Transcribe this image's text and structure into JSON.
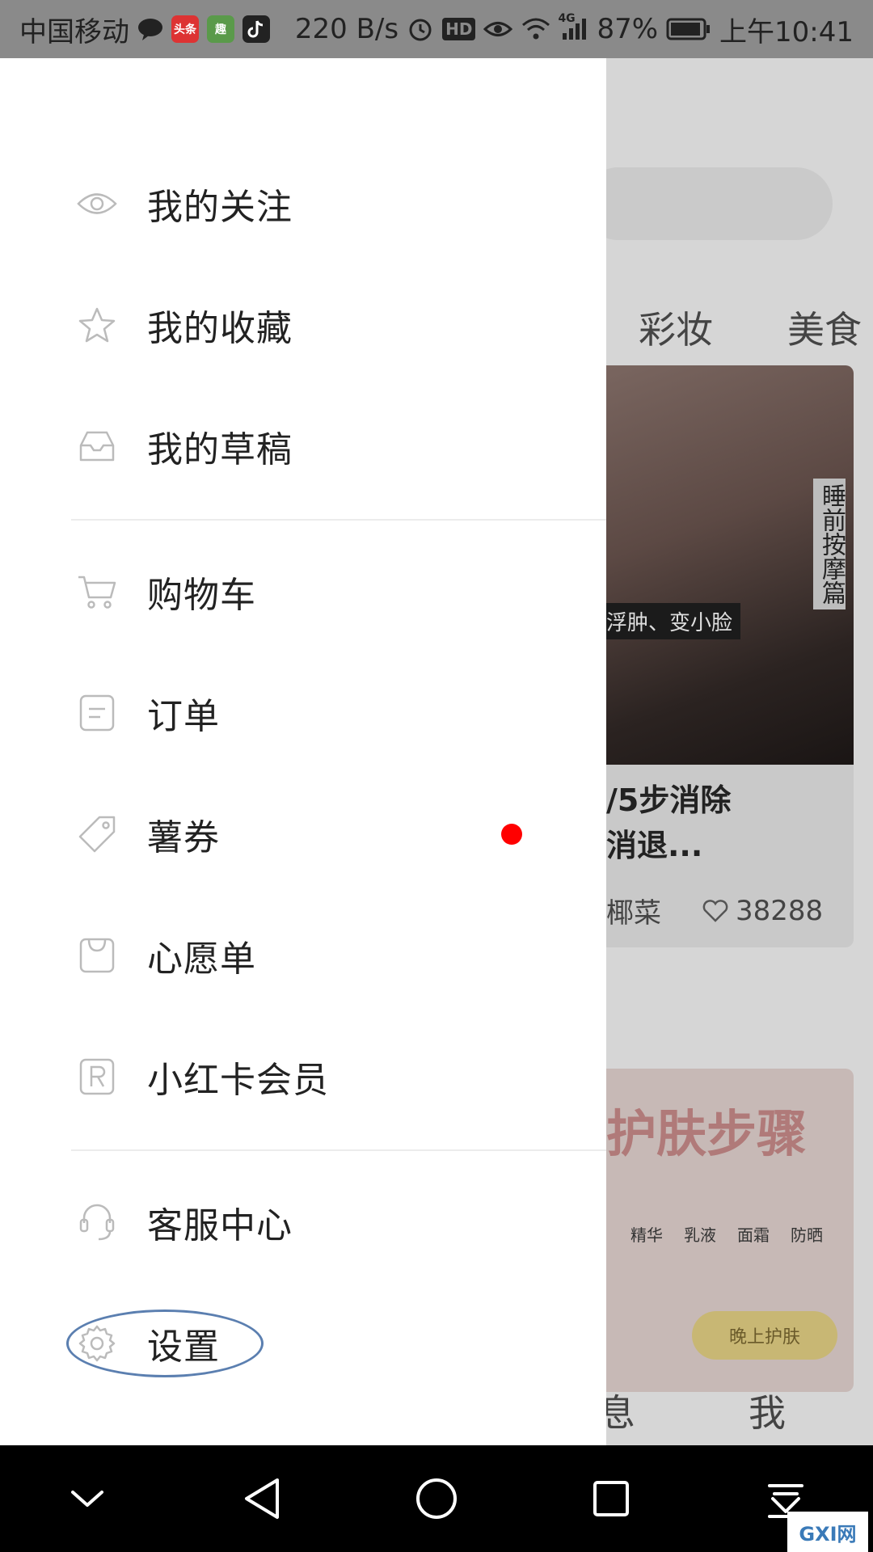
{
  "status_bar": {
    "carrier": "中国移动",
    "app_badges": [
      "头条",
      "趣"
    ],
    "network_speed": "220 B/s",
    "hd_label": "HD",
    "network_type": "4G",
    "battery": "87%",
    "time": "上午10:41"
  },
  "background": {
    "tabs": [
      "彩妆",
      "美食"
    ],
    "card": {
      "vertical_label": "睡前按摩篇",
      "caption": "浮肿、变小脸",
      "title_lines": [
        "/5步消除",
        "消退..."
      ],
      "author": "椰菜",
      "likes": "38288"
    },
    "card2": {
      "banner": "护肤步骤",
      "labels": [
        "精华",
        "乳液",
        "面霜",
        "防晒"
      ],
      "button": "晚上护肤"
    },
    "bottom_tabs": [
      "息",
      "我"
    ]
  },
  "drawer": {
    "items": [
      {
        "label": "我的关注",
        "icon": "eye-icon"
      },
      {
        "label": "我的收藏",
        "icon": "star-icon"
      },
      {
        "label": "我的草稿",
        "icon": "inbox-icon"
      },
      {
        "label": "购物车",
        "icon": "cart-icon"
      },
      {
        "label": "订单",
        "icon": "order-icon"
      },
      {
        "label": "薯券",
        "icon": "coupon-tag-icon"
      },
      {
        "label": "心愿单",
        "icon": "bag-icon"
      },
      {
        "label": "小红卡会员",
        "icon": "member-r-icon"
      },
      {
        "label": "客服中心",
        "icon": "headset-icon"
      },
      {
        "label": "设置",
        "icon": "gear-icon"
      }
    ],
    "coupon_badge_color": "#ff0000",
    "annotation_color": "#5b7fb0"
  },
  "nav_bar": {
    "buttons": [
      "collapse-icon",
      "back-icon",
      "home-icon",
      "recents-icon",
      "notification-pull-icon"
    ]
  },
  "watermark": "GXI网"
}
